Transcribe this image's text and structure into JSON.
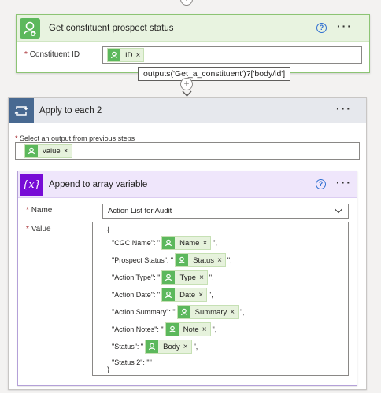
{
  "step1": {
    "title": "Get constituent prospect status",
    "field_label": "Constituent ID",
    "required_mark": "*",
    "token": "ID",
    "tooltip": "outputs('Get_a_constituent')?['body/id']"
  },
  "loop": {
    "title": "Apply to each 2",
    "field_label": "Select an output from previous steps",
    "required_mark": "*",
    "token": "value"
  },
  "append": {
    "title": "Append to array variable",
    "name_label": "Name",
    "name_value": "Action List for Audit",
    "value_label": "Value",
    "required_mark": "*",
    "open_brace": "{",
    "close_brace": "}",
    "lines": [
      {
        "prefix": "\"CGC Name\": \"",
        "token": "Name",
        "suffix": "\","
      },
      {
        "prefix": "\"Prospect Status\": \"",
        "token": "Status",
        "suffix": "\","
      },
      {
        "prefix": "\"Action Type\": \"",
        "token": "Type",
        "suffix": "\","
      },
      {
        "prefix": "\"Action Date\": \"",
        "token": "Date",
        "suffix": "\","
      },
      {
        "prefix": "\"Action Summary\": \"",
        "token": "Summary",
        "suffix": "\","
      },
      {
        "prefix": "\"Action Notes\": \"",
        "token": "Note",
        "suffix": "\","
      },
      {
        "prefix": "\"Status\": \"",
        "token": "Body",
        "suffix": "\","
      },
      {
        "prefix": "\"Status 2\": \"\"",
        "token": "",
        "suffix": ""
      }
    ]
  },
  "icons": {
    "help": "?",
    "more": "···",
    "remove": "×"
  },
  "colors": {
    "green_accent": "#5cb85c",
    "loop_accent": "#486991",
    "variable_accent": "#770bd6",
    "help_blue": "#2f6fd1"
  }
}
